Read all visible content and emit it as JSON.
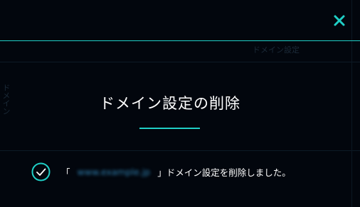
{
  "dialog": {
    "title": "ドメイン設定の削除",
    "message": {
      "open_bracket": "「",
      "domain": "www.example.jp",
      "close_bracket_and_text": "」ドメイン設定を削除しました。"
    },
    "close_icon": "close-icon",
    "status_icon": "check-circle-icon"
  },
  "background_page": {
    "label_top_right": "ドメイン設定",
    "label_left_vertical": "ドメイン"
  },
  "colors": {
    "accent": "#1fcfc6",
    "background": "#02060d",
    "text": "#ffffff"
  }
}
